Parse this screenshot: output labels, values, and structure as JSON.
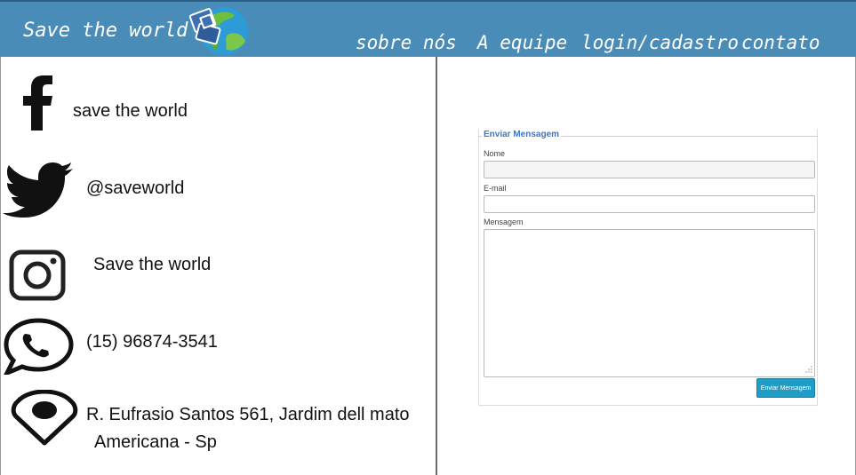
{
  "header": {
    "brand": "Save the world",
    "nav": [
      {
        "label": "sobre nós"
      },
      {
        "label": "A equipe"
      },
      {
        "label": "login/cadastro"
      },
      {
        "label": "contato"
      }
    ]
  },
  "contacts": {
    "facebook": {
      "text": "save the world",
      "icon": "facebook-icon"
    },
    "twitter": {
      "text": "@saveworld",
      "icon": "twitter-icon"
    },
    "instagram": {
      "text": "Save the world",
      "icon": "instagram-icon"
    },
    "whatsapp": {
      "text": "(15) 96874-3541",
      "icon": "whatsapp-icon"
    },
    "location": {
      "line1": "R. Eufrasio Santos 561, Jardim dell mato",
      "line2": "Americana - Sp",
      "icon": "map-pin-icon"
    }
  },
  "form": {
    "legend": "Enviar Mensagem",
    "name_label": "Nome",
    "name_value": "",
    "email_label": "E-mail",
    "email_value": "",
    "message_label": "Mensagem",
    "message_value": "",
    "submit_label": "Enviar Mensagem"
  },
  "colors": {
    "header_bg": "#4a8cb8",
    "legend": "#3a78c9",
    "button": "#1f9dc4"
  }
}
